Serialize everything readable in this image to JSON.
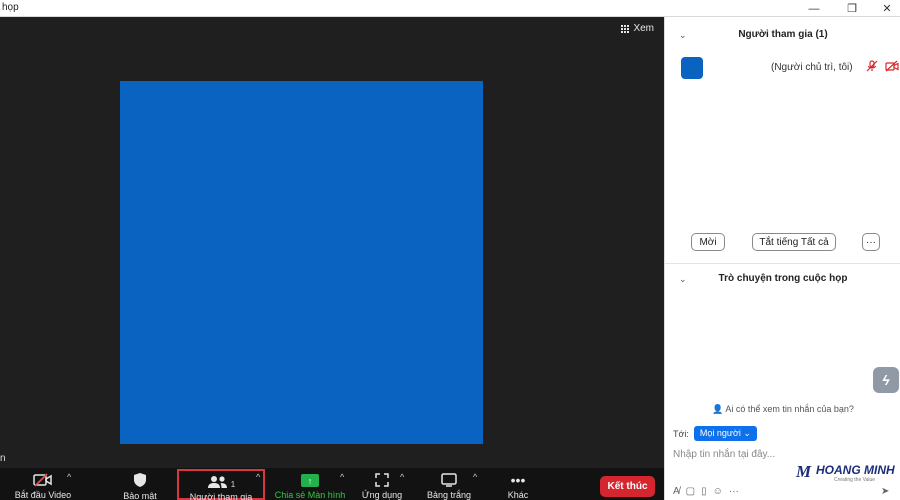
{
  "window": {
    "title": "họp",
    "controls": {
      "minimize": "—",
      "maximize": "❐",
      "close": "✕"
    }
  },
  "stage": {
    "view_label": "Xem",
    "view_icon": "grid-icon",
    "tile_color": "#0a63c1",
    "name_tag": "n"
  },
  "toolbar": {
    "video": {
      "label": "Bắt đầu Video",
      "icon": "video-off-icon"
    },
    "security": {
      "label": "Bảo mật",
      "icon": "shield-icon"
    },
    "participants": {
      "label": "Người tham gia",
      "icon": "people-icon",
      "count": "1"
    },
    "share": {
      "label": "Chia sẻ Màn hình",
      "icon": "share-screen-icon"
    },
    "apps": {
      "label": "Ứng dụng",
      "icon": "apps-icon"
    },
    "whiteboard": {
      "label": "Bảng trắng",
      "icon": "whiteboard-icon"
    },
    "more": {
      "label": "Khác",
      "icon": "more-icon"
    },
    "end": {
      "label": "Kết thúc"
    },
    "caret": "^"
  },
  "participants_panel": {
    "title": "Người tham gia (1)",
    "participants": [
      {
        "role": "(Người chủ trì, tôi)",
        "avatar_color": "#0a63c1",
        "mic_icon": "mic-muted-icon",
        "cam_icon": "video-muted-icon"
      }
    ],
    "invite_label": "Mời",
    "mute_all_label": "Tắt tiếng Tất cả",
    "more_label": "···"
  },
  "chat_panel": {
    "title": "Trò chuyện trong cuộc họp",
    "who_can_see": "Ai có thể xem tin nhắn của bạn?",
    "to_label": "Tới:",
    "to_value": "Mọi người",
    "input_placeholder": "Nhập tin nhắn tại đây..."
  },
  "logo": {
    "name": "HOANG MINH",
    "tagline": "Creating the Value"
  },
  "colors": {
    "end_button": "#d5262f",
    "share_green": "#23b14d",
    "accent_blue": "#0e71eb",
    "highlight_red": "#d9363e"
  }
}
